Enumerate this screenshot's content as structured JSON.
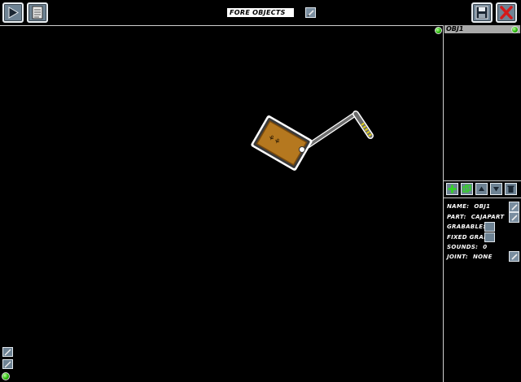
{
  "toolbar": {
    "layer_label": "FORE OBJECTS",
    "icons": [
      "play-icon",
      "notepad-icon",
      "edit-icon",
      "save-icon",
      "close-icon"
    ]
  },
  "object_list": {
    "items": [
      "OBJ1"
    ]
  },
  "tools": [
    "add-icon",
    "duplicate-icon",
    "move-up-icon",
    "move-down-icon",
    "delete-icon"
  ],
  "properties": {
    "name_label": "NAME:",
    "name_value": "OBJ1",
    "part_label": "PART:",
    "part_value": "CAJAPART",
    "grabable_label": "GRABABLE:",
    "fixed_grab_label": "FIXED GRAB:",
    "sounds_label": "SOUNDS:",
    "sounds_value": "0",
    "joint_label": "JOINT:",
    "joint_value": "NONE"
  },
  "colors": {
    "button_fill": "#6e8394",
    "close_red": "#d41a1a",
    "status_green": "#21b300",
    "crate": "#b5781f"
  }
}
